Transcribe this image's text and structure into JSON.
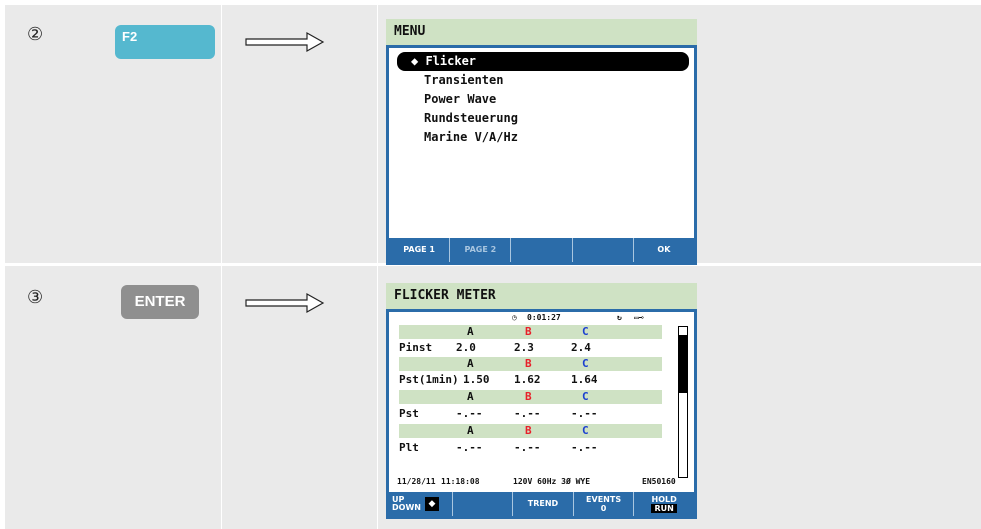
{
  "step1": {
    "number": "②",
    "key": "F2",
    "screen": {
      "title": "MENU",
      "items": [
        "◆ Flicker",
        "Transienten",
        "Power Wave",
        "Rundsteuerung",
        "Marine V/A/Hz"
      ],
      "fkeys": [
        "PAGE 1",
        "PAGE 2",
        "",
        "",
        "OK"
      ]
    }
  },
  "step2": {
    "number": "③",
    "key": "ENTER",
    "screen": {
      "title": "FLICKER METER",
      "timer": "0:01:27",
      "phase_headers": [
        "A",
        "B",
        "C"
      ],
      "rows": [
        {
          "label": "Pinst",
          "a": "2.0",
          "b": "2.3",
          "c": "2.4"
        },
        {
          "label": "Pst(1min)",
          "a": "1.50",
          "b": "1.62",
          "c": "1.64"
        },
        {
          "label": "Pst",
          "a": "-.--",
          "b": "-.--",
          "c": "-.--"
        },
        {
          "label": "Plt",
          "a": "-.--",
          "b": "-.--",
          "c": "-.--"
        }
      ],
      "footer": {
        "date": "11/28/11",
        "time": "11:18:08",
        "config": "120V 60Hz 3Ø WYE",
        "standard": "EN50160"
      },
      "fkeys": {
        "f1_line1": "UP",
        "f1_line2": "DOWN",
        "f1_icon": "◆",
        "f2": "",
        "f3": "TREND",
        "f4_line1": "EVENTS",
        "f4_line2": "0",
        "f5_line1": "HOLD",
        "f5_line2": "RUN"
      }
    }
  },
  "colors": {
    "phase_a": "#111111",
    "phase_b": "#e8202a",
    "phase_c": "#1a3fd0",
    "f2_key": "#55b8cf",
    "enter_key": "#8f8f8f",
    "lcd_frame": "#2b6ca9",
    "header_green": "#cfe2c4"
  }
}
